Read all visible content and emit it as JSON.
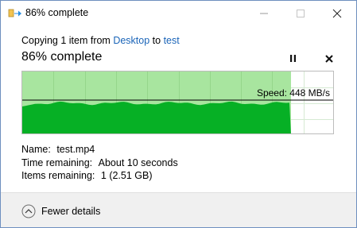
{
  "window": {
    "title": "86% complete",
    "icon": "file-copy-icon",
    "controls": [
      "minimize-icon",
      "maximize-icon",
      "close-icon"
    ]
  },
  "header": {
    "copy_prefix": "Copying 1 item from ",
    "source": "Desktop",
    "copy_to": " to ",
    "destination": "test",
    "progress_label": "86% complete",
    "progress_fraction": 0.86
  },
  "graph": {
    "speed_label": "Speed: 448 MB/s",
    "fill_color": "#06b025",
    "background_color": "#a8e59f"
  },
  "details": {
    "name_label": "Name:",
    "name_value": "test.mp4",
    "time_label": "Time remaining:",
    "time_value": "About 10 seconds",
    "items_label": "Items remaining:",
    "items_value": "1 (2.51 GB)"
  },
  "footer": {
    "toggle_label": "Fewer details",
    "toggle_icon": "chevron-up-circle-icon"
  },
  "colors": {
    "link": "#1a64b8",
    "footer_bg": "#f0f0f0"
  }
}
